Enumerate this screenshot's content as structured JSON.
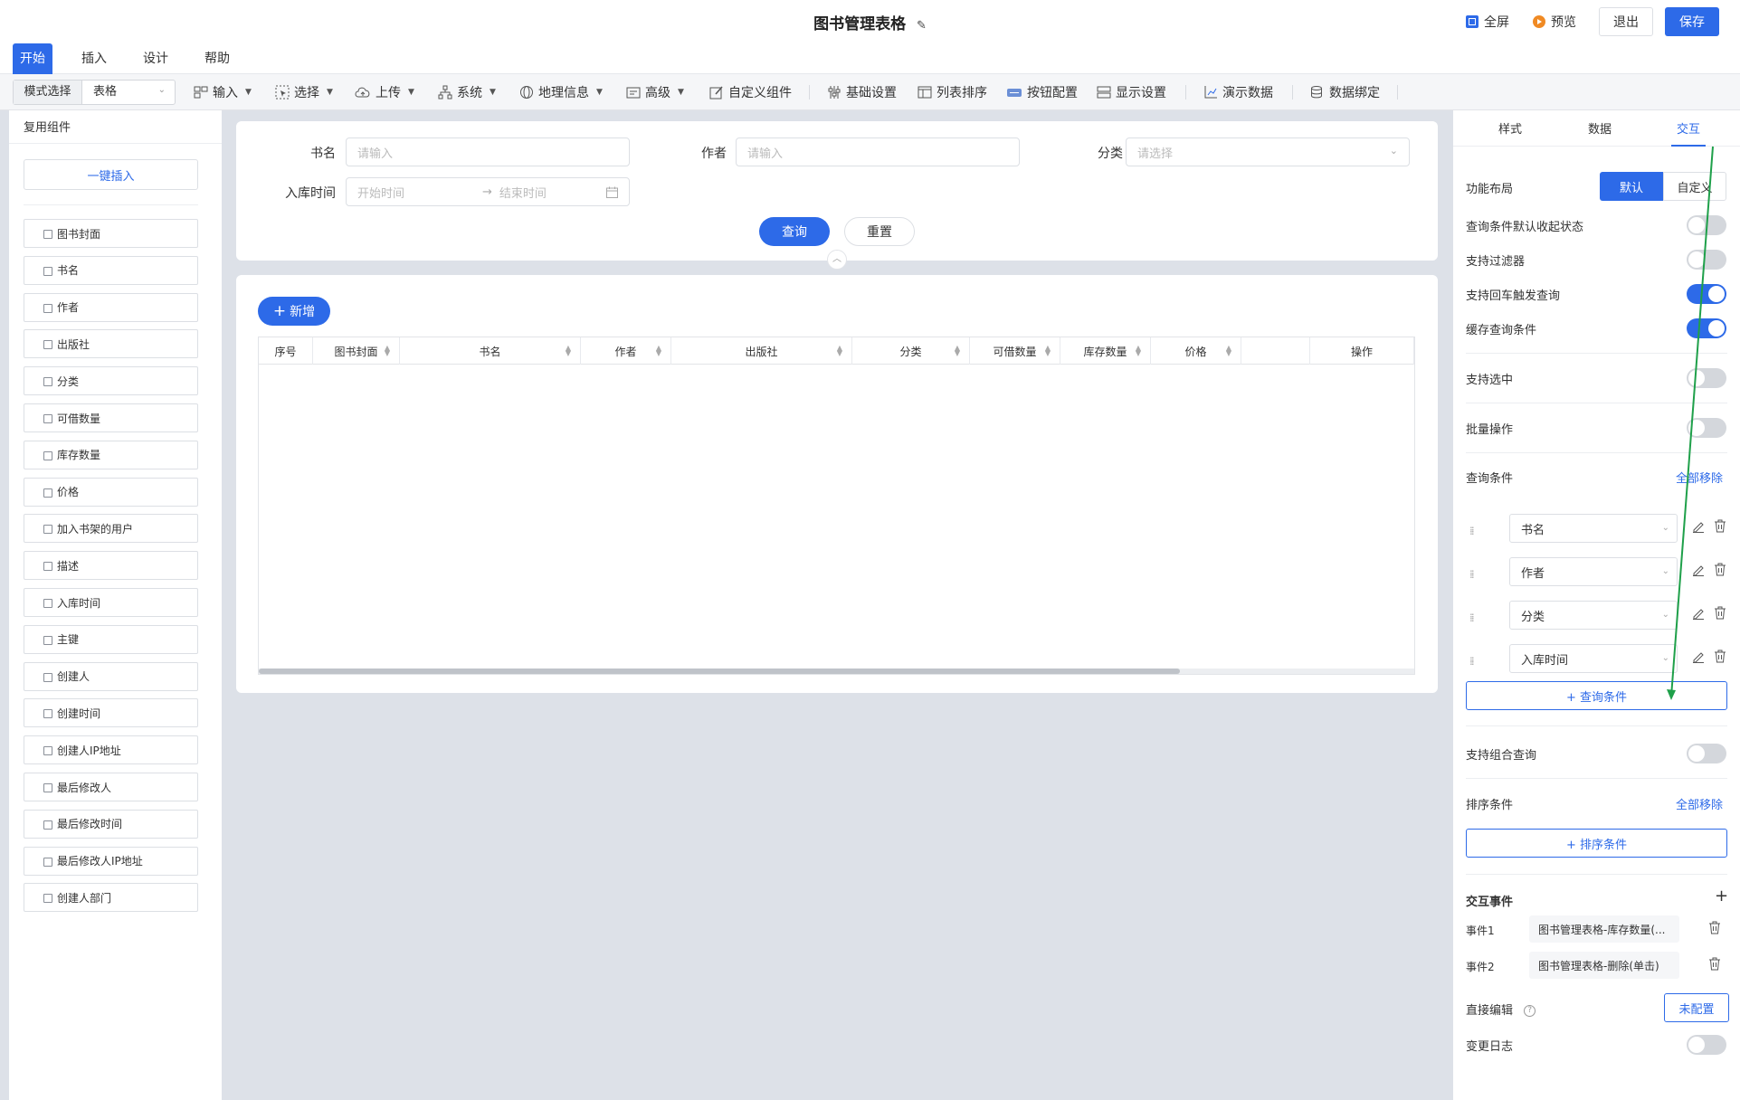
{
  "header": {
    "title": "图书管理表格",
    "fullscreen": "全屏",
    "preview": "预览",
    "exit": "退出",
    "save": "保存"
  },
  "menu_tabs": [
    "开始",
    "插入",
    "设计",
    "帮助"
  ],
  "toolbar": {
    "mode_label": "模式选择",
    "mode_value": "表格",
    "items": [
      "输入",
      "选择",
      "上传",
      "系统",
      "地理信息",
      "高级",
      "自定义组件",
      "基础设置",
      "列表排序",
      "按钮配置",
      "显示设置",
      "演示数据",
      "数据绑定"
    ]
  },
  "left_panel": {
    "title": "复用组件",
    "insert_button": "一键插入",
    "items": [
      "图书封面",
      "书名",
      "作者",
      "出版社",
      "分类",
      "可借数量",
      "库存数量",
      "价格",
      "加入书架的用户",
      "描述",
      "入库时间",
      "主键",
      "创建人",
      "创建时间",
      "创建人IP地址",
      "最后修改人",
      "最后修改时间",
      "最后修改人IP地址",
      "创建人部门"
    ]
  },
  "search_form": {
    "book_name_label": "书名",
    "book_name_placeholder": "请输入",
    "author_label": "作者",
    "author_placeholder": "请输入",
    "category_label": "分类",
    "category_placeholder": "请选择",
    "date_label": "入库时间",
    "date_start": "开始时间",
    "date_end": "结束时间",
    "query_button": "查询",
    "reset_button": "重置"
  },
  "table": {
    "add_button": "新增",
    "columns": [
      "序号",
      "图书封面",
      "书名",
      "作者",
      "出版社",
      "分类",
      "可借数量",
      "库存数量",
      "价格",
      "",
      "操作"
    ]
  },
  "right_panel": {
    "tabs": [
      "样式",
      "数据",
      "交互"
    ],
    "active_tab": "交互",
    "layout_label": "功能布局",
    "layout_default": "默认",
    "layout_custom": "自定义",
    "settings": [
      {
        "label": "查询条件默认收起状态",
        "on": false
      },
      {
        "label": "支持过滤器",
        "on": false
      },
      {
        "label": "支持回车触发查询",
        "on": true
      },
      {
        "label": "缓存查询条件",
        "on": true
      },
      {
        "label": "支持选中",
        "on": false
      },
      {
        "label": "批量操作",
        "on": false
      }
    ],
    "query_conditions_title": "查询条件",
    "remove_all": "全部移除",
    "query_conditions": [
      "书名",
      "作者",
      "分类",
      "入库时间"
    ],
    "add_query_condition": "+ 查询条件",
    "combo_query_label": "支持组合查询",
    "combo_query_on": false,
    "sort_conditions_title": "排序条件",
    "sort_remove_all": "全部移除",
    "add_sort_condition": "+ 排序条件",
    "events_title": "交互事件",
    "events": [
      {
        "label": "事件1",
        "value": "图书管理表格-库存数量(..."
      },
      {
        "label": "事件2",
        "value": "图书管理表格-删除(单击)"
      }
    ],
    "direct_edit_label": "直接编辑",
    "direct_edit_button": "未配置",
    "change_log_label": "变更日志",
    "change_log_on": false
  },
  "colors": {
    "accent": "#2d6ae8",
    "annotation_arrow": "#1fa04a",
    "canvas_bg": "#dde1e8"
  }
}
